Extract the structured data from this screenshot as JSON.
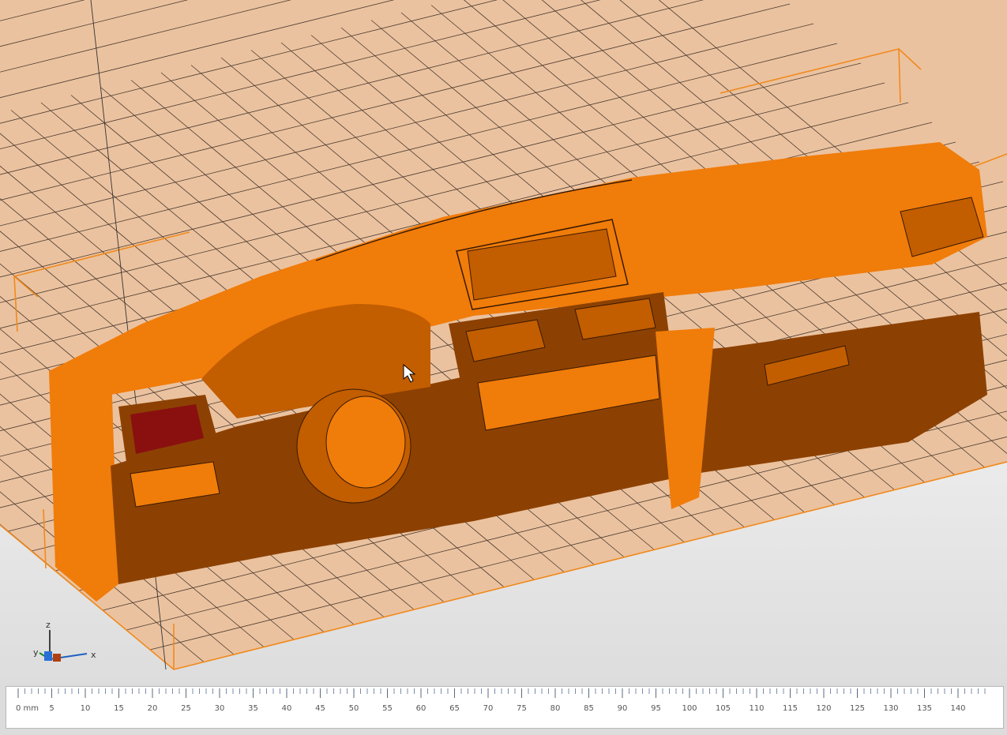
{
  "viewport": {
    "bed_color": "#ebc29f",
    "bed_edge_color": "#f08a1e",
    "model_color": "#f07c0a",
    "model_shade": "#8c4102",
    "model_mid": "#c25d00",
    "vent_highlight": "#8a1010",
    "background_color": "#e6e6e6"
  },
  "axis_gizmo": {
    "labels": {
      "z": "z",
      "y": "y",
      "x": "x"
    },
    "colors": {
      "x": "#2060c0",
      "y": "#1a8a2a",
      "z": "#404040"
    }
  },
  "ruler": {
    "unit_label": "0 mm",
    "labels": [
      "5",
      "10",
      "15",
      "20",
      "25",
      "30",
      "35",
      "40",
      "45",
      "50",
      "55",
      "60",
      "65",
      "70",
      "75",
      "80",
      "85",
      "90",
      "95",
      "100",
      "105",
      "110",
      "115",
      "120",
      "125",
      "130",
      "135",
      "140"
    ]
  }
}
